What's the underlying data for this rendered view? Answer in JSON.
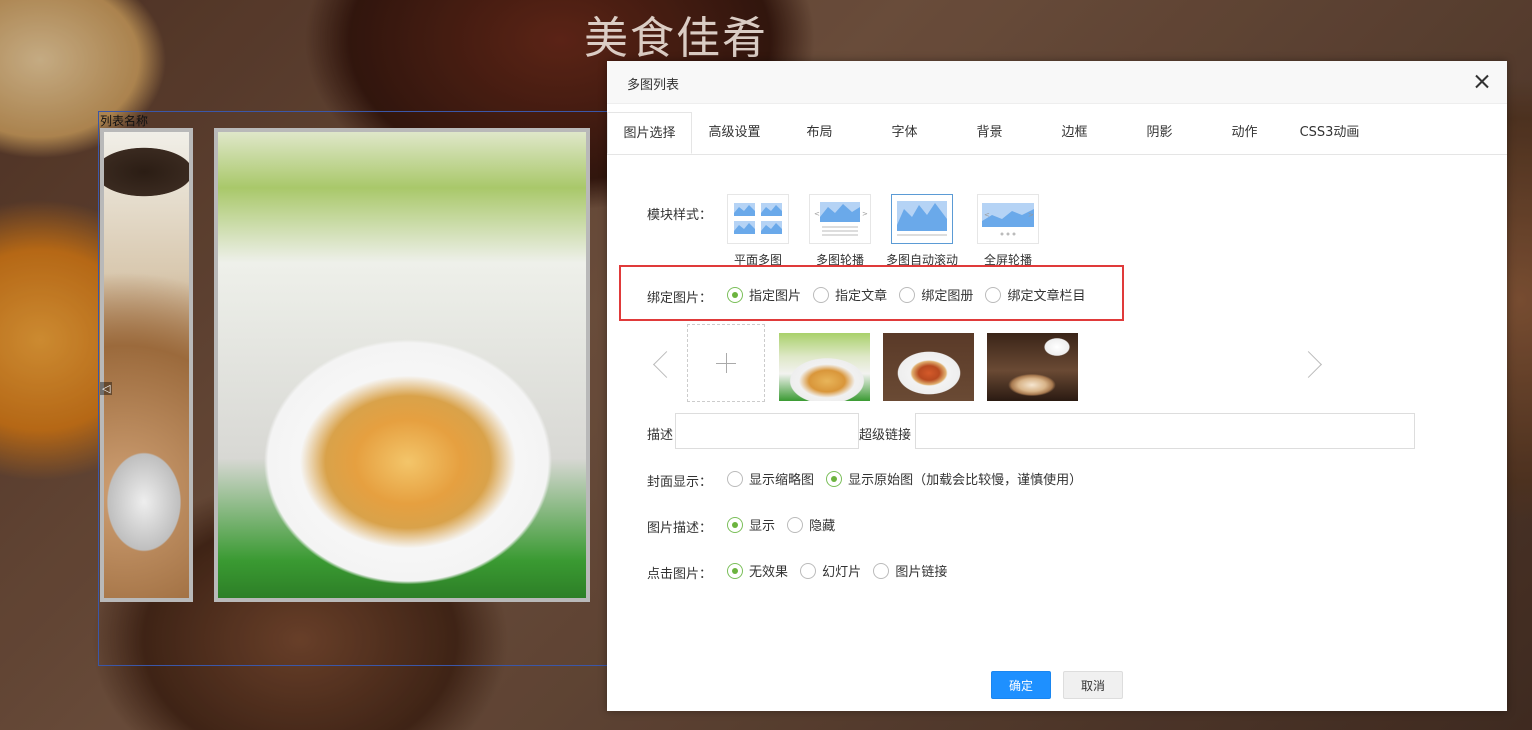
{
  "site": {
    "title": "美食佳肴"
  },
  "module": {
    "label": "列表名称"
  },
  "dialog": {
    "title": "多图列表",
    "tabs": [
      {
        "label": "图片选择"
      },
      {
        "label": "高级设置"
      },
      {
        "label": "布局"
      },
      {
        "label": "字体"
      },
      {
        "label": "背景"
      },
      {
        "label": "边框"
      },
      {
        "label": "阴影"
      },
      {
        "label": "动作"
      },
      {
        "label": "CSS3动画"
      }
    ],
    "module_style": {
      "label": "模块样式：",
      "options": [
        {
          "caption": "平面多图"
        },
        {
          "caption": "多图轮播"
        },
        {
          "caption": "多图自动滚动",
          "selected": true
        },
        {
          "caption": "全屏轮播"
        }
      ]
    },
    "bind_image": {
      "label": "绑定图片：",
      "options": [
        {
          "label": "指定图片",
          "checked": true
        },
        {
          "label": "指定文章"
        },
        {
          "label": "绑定图册"
        },
        {
          "label": "绑定文章栏目"
        }
      ]
    },
    "fields": {
      "desc_label": "描述",
      "desc_value": "",
      "link_label": "超级链接",
      "link_value": ""
    },
    "cover_display": {
      "label": "封面显示：",
      "options": [
        {
          "label": "显示缩略图"
        },
        {
          "label": "显示原始图（加载会比较慢，谨慎使用）",
          "checked": true
        }
      ]
    },
    "image_desc": {
      "label": "图片描述：",
      "options": [
        {
          "label": "显示",
          "checked": true
        },
        {
          "label": "隐藏"
        }
      ]
    },
    "click_image": {
      "label": "点击图片：",
      "options": [
        {
          "label": "无效果",
          "checked": true
        },
        {
          "label": "幻灯片"
        },
        {
          "label": "图片链接"
        }
      ]
    },
    "buttons": {
      "ok": "确定",
      "cancel": "取消"
    }
  },
  "colors": {
    "accent": "#1e90ff",
    "radio_on": "#6cb33f",
    "highlight": "#e03a3a",
    "frame": "#3b57a8"
  }
}
